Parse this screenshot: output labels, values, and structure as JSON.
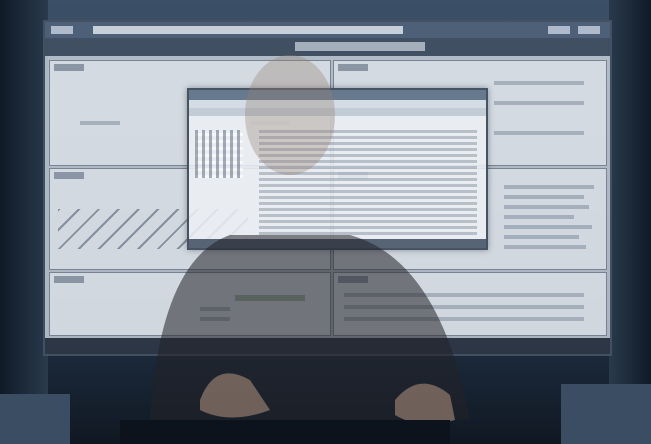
{
  "scene": {
    "description_tags": [
      "person-at-keyboard",
      "transparent-display",
      "dashboard-ui"
    ]
  }
}
